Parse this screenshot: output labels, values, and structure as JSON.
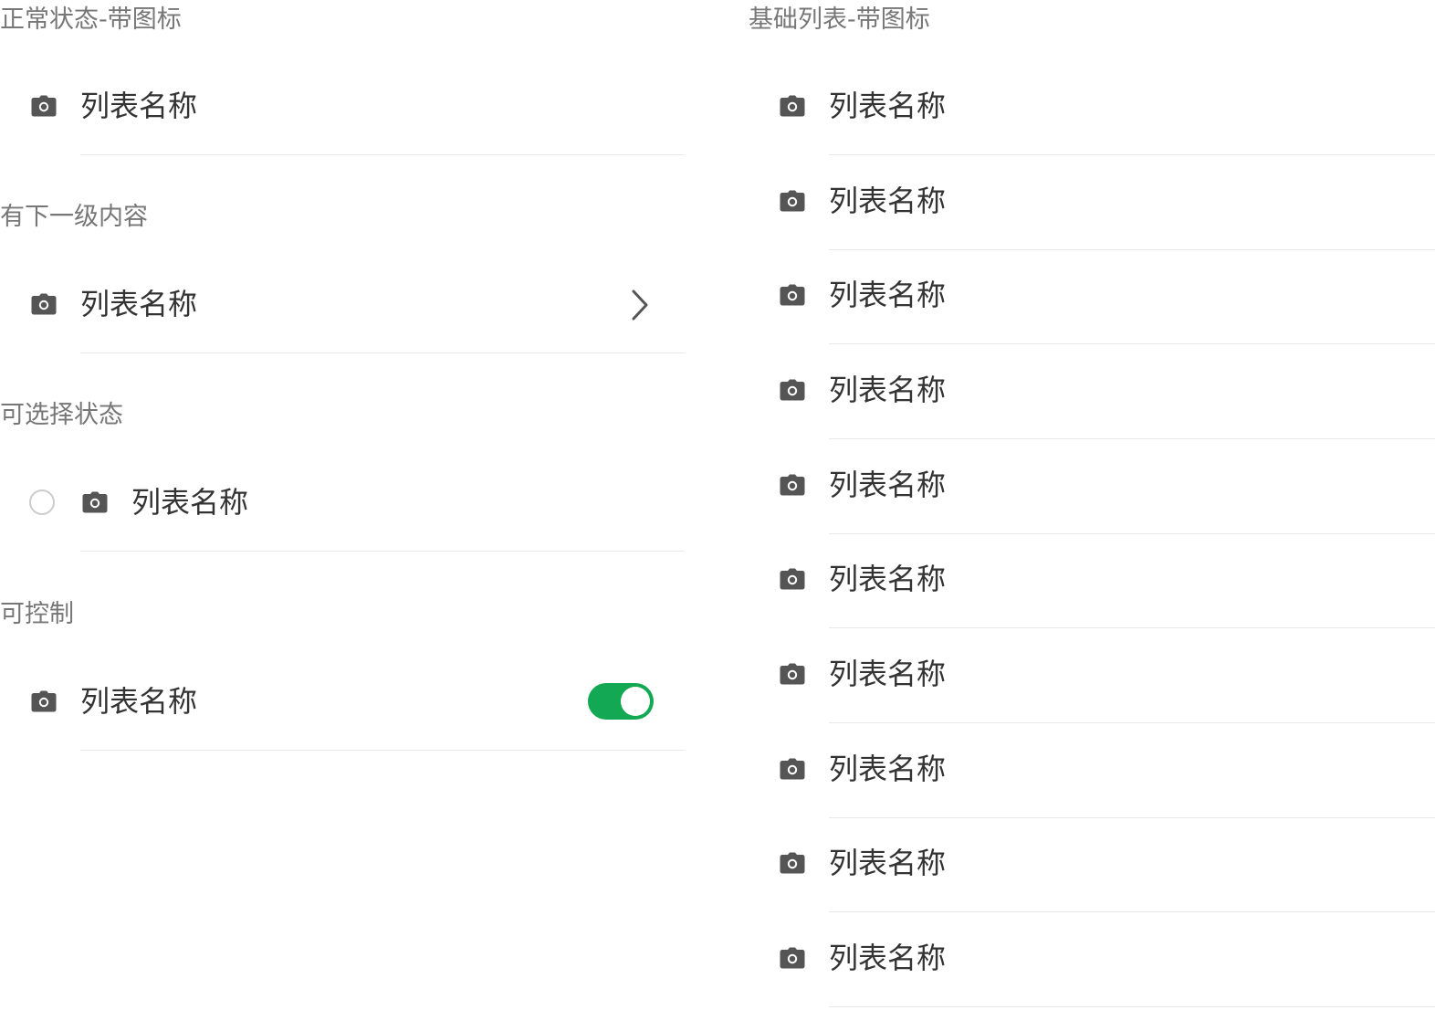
{
  "left": {
    "normal": {
      "title": "正常状态-带图标",
      "item": {
        "label": "列表名称",
        "icon": "camera-icon"
      }
    },
    "submenu": {
      "title": "有下一级内容",
      "item": {
        "label": "列表名称",
        "icon": "camera-icon",
        "trailing": "chevron-right-icon"
      }
    },
    "selectable": {
      "title": "可选择状态",
      "item": {
        "label": "列表名称",
        "icon": "camera-icon",
        "selected": false
      }
    },
    "controllable": {
      "title": "可控制",
      "item": {
        "label": "列表名称",
        "icon": "camera-icon",
        "toggle_on": true
      }
    }
  },
  "right": {
    "title": "基础列表-带图标",
    "items": [
      {
        "label": "列表名称",
        "icon": "camera-icon"
      },
      {
        "label": "列表名称",
        "icon": "camera-icon"
      },
      {
        "label": "列表名称",
        "icon": "camera-icon"
      },
      {
        "label": "列表名称",
        "icon": "camera-icon"
      },
      {
        "label": "列表名称",
        "icon": "camera-icon"
      },
      {
        "label": "列表名称",
        "icon": "camera-icon"
      },
      {
        "label": "列表名称",
        "icon": "camera-icon"
      },
      {
        "label": "列表名称",
        "icon": "camera-icon"
      },
      {
        "label": "列表名称",
        "icon": "camera-icon"
      },
      {
        "label": "列表名称",
        "icon": "camera-icon"
      }
    ]
  },
  "colors": {
    "toggle_on": "#12a854",
    "icon": "#555555",
    "divider": "#e9e9e9",
    "section_title": "#777777",
    "text": "#333333"
  }
}
